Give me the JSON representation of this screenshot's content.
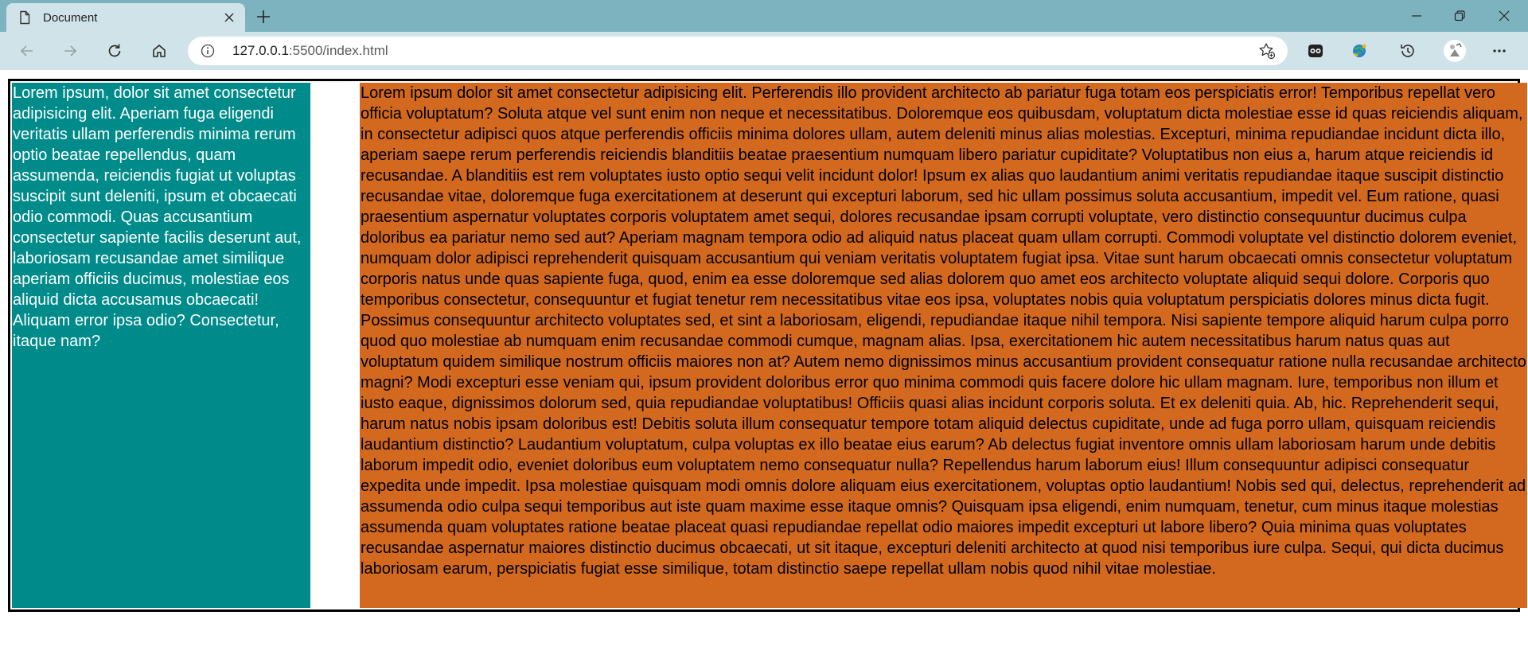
{
  "browser": {
    "tab": {
      "title": "Document"
    },
    "address": {
      "host": "127.0.0.1",
      "path": ":5500/index.html"
    }
  },
  "page": {
    "sidebar_text": "Lorem ipsum, dolor sit amet consectetur adipisicing elit. Aperiam fuga eligendi veritatis ullam perferendis minima rerum optio beatae repellendus, quam assumenda, reiciendis fugiat ut voluptas suscipit sunt deleniti, ipsum et obcaecati odio commodi. Quas accusantium consectetur sapiente facilis deserunt aut, laboriosam recusandae amet similique aperiam officiis ducimus, molestiae eos aliquid dicta accusamus obcaecati! Aliquam error ipsa odio? Consectetur, itaque nam?",
    "main_text": "Lorem ipsum dolor sit amet consectetur adipisicing elit. Perferendis illo provident architecto ab pariatur fuga totam eos perspiciatis error! Temporibus repellat vero officia voluptatum? Soluta atque vel sunt enim non neque et necessitatibus. Doloremque eos quibusdam, voluptatum dicta molestiae esse id quas reiciendis aliquam, in consectetur adipisci quos atque perferendis officiis minima dolores ullam, autem deleniti minus alias molestias. Excepturi, minima repudiandae incidunt dicta illo, aperiam saepe rerum perferendis reiciendis blanditiis beatae praesentium numquam libero pariatur cupiditate? Voluptatibus non eius a, harum atque reiciendis id recusandae. A blanditiis est rem voluptates iusto optio sequi velit incidunt dolor! Ipsum ex alias quo laudantium animi veritatis repudiandae itaque suscipit distinctio recusandae vitae, doloremque fuga exercitationem at deserunt qui excepturi laborum, sed hic ullam possimus soluta accusantium, impedit vel. Eum ratione, quasi praesentium aspernatur voluptates corporis voluptatem amet sequi, dolores recusandae ipsam corrupti voluptate, vero distinctio consequuntur ducimus culpa doloribus ea pariatur nemo sed aut? Aperiam magnam tempora odio ad aliquid natus placeat quam ullam corrupti. Commodi voluptate vel distinctio dolorem eveniet, numquam dolor adipisci reprehenderit quisquam accusantium qui veniam veritatis voluptatem fugiat ipsa. Vitae sunt harum obcaecati omnis consectetur voluptatum corporis natus unde quas sapiente fuga, quod, enim ea esse doloremque sed alias dolorem quo amet eos architecto voluptate aliquid sequi dolore. Corporis quo temporibus consectetur, consequuntur et fugiat tenetur rem necessitatibus vitae eos ipsa, voluptates nobis quia voluptatum perspiciatis dolores minus dicta fugit. Possimus consequuntur architecto voluptates sed, et sint a laboriosam, eligendi, repudiandae itaque nihil tempora. Nisi sapiente tempore aliquid harum culpa porro quod quo molestiae ab numquam enim recusandae commodi cumque, magnam alias. Ipsa, exercitationem hic autem necessitatibus harum natus quas aut voluptatum quidem similique nostrum officiis maiores non at? Autem nemo dignissimos minus accusantium provident consequatur ratione nulla recusandae architecto magni? Modi excepturi esse veniam qui, ipsum provident doloribus error quo minima commodi quis facere dolore hic ullam magnam. Iure, temporibus non illum et iusto eaque, dignissimos dolorum sed, quia repudiandae voluptatibus! Officiis quasi alias incidunt corporis soluta. Et ex deleniti quia. Ab, hic. Reprehenderit sequi, harum natus nobis ipsam doloribus est! Debitis soluta illum consequatur tempore totam aliquid delectus cupiditate, unde ad fuga porro ullam, quisquam reiciendis laudantium distinctio? Laudantium voluptatum, culpa voluptas ex illo beatae eius earum? Ab delectus fugiat inventore omnis ullam laboriosam harum unde debitis laborum impedit odio, eveniet doloribus eum voluptatem nemo consequatur nulla? Repellendus harum laborum eius! Illum consequuntur adipisci consequatur expedita unde impedit. Ipsa molestiae quisquam modi omnis dolore aliquam eius exercitationem, voluptas optio laudantium! Nobis sed qui, delectus, reprehenderit ad assumenda odio culpa sequi temporibus aut iste quam maxime esse itaque omnis? Quisquam ipsa eligendi, enim numquam, tenetur, cum minus itaque molestias assumenda quam voluptates ratione beatae placeat quasi repudiandae repellat odio maiores impedit excepturi ut labore libero? Quia minima quas voluptates recusandae aspernatur maiores distinctio ducimus obcaecati, ut sit itaque, excepturi deleniti architecto at quod nisi temporibus iure culpa. Sequi, qui dicta ducimus laboriosam earum, perspiciatis fugiat esse similique, totam distinctio saepe repellat ullam nobis quod nihil vitae molestiae."
  },
  "colors": {
    "titlebar": "#7db3bf",
    "toolbar": "#cfe3e8",
    "sidebar_bg": "#008b8b",
    "main_bg": "#d2691e",
    "border": "#000000"
  },
  "icons": {
    "tab": "document-icon",
    "tab_close": "close-icon",
    "new_tab": "plus-icon",
    "minimize": "minimize-icon",
    "restore": "restore-icon",
    "close_window": "close-icon",
    "back": "back-arrow-icon",
    "forward": "forward-arrow-icon",
    "refresh": "refresh-icon",
    "home": "home-icon",
    "site_info": "info-icon",
    "favorites": "star-plus-icon",
    "extension_1": "extension-icon",
    "extension_2": "globe-extension-icon",
    "history": "history-icon",
    "profile": "profile-avatar-icon",
    "menu": "more-dots-icon"
  }
}
